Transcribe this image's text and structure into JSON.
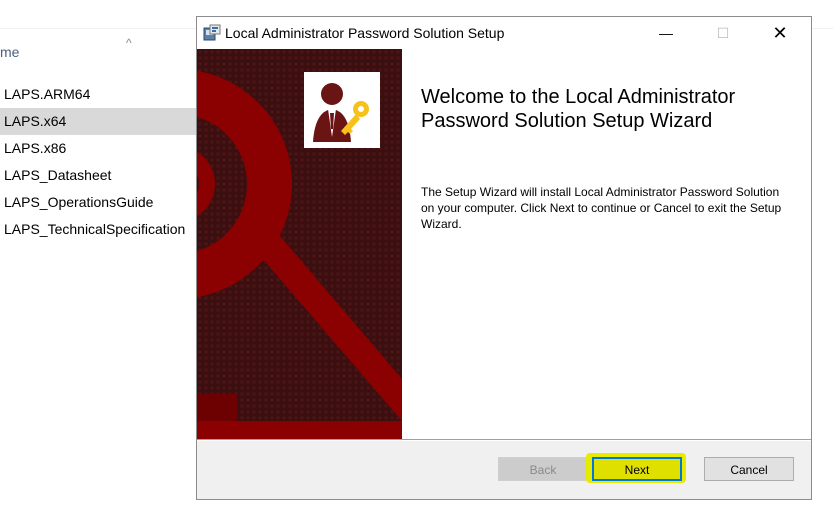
{
  "explorer": {
    "column_header": "me",
    "files": [
      {
        "name": "LAPS.ARM64",
        "selected": false
      },
      {
        "name": "LAPS.x64",
        "selected": true
      },
      {
        "name": "LAPS.x86",
        "selected": false
      },
      {
        "name": "LAPS_Datasheet",
        "selected": false
      },
      {
        "name": "LAPS_OperationsGuide",
        "selected": false
      },
      {
        "name": "LAPS_TechnicalSpecification",
        "selected": false
      }
    ]
  },
  "window": {
    "title": "Local Administrator Password Solution Setup",
    "minimize_glyph": "—",
    "maximize_glyph": "☐",
    "close_glyph": "✕",
    "heading": "Welcome to the Local Administrator Password Solution Setup Wizard",
    "body": "The Setup Wizard will install Local Administrator Password Solution on your computer. Click Next to continue or Cancel to exit the Setup Wizard.",
    "buttons": {
      "back": "Back",
      "next": "Next",
      "cancel": "Cancel"
    },
    "icons": {
      "app": "installer-icon",
      "banner_logo": "user-key-icon"
    },
    "colors": {
      "banner_dark": "#3b0f10",
      "banner_red": "#8b0000",
      "highlight": "#e6eb00"
    }
  }
}
